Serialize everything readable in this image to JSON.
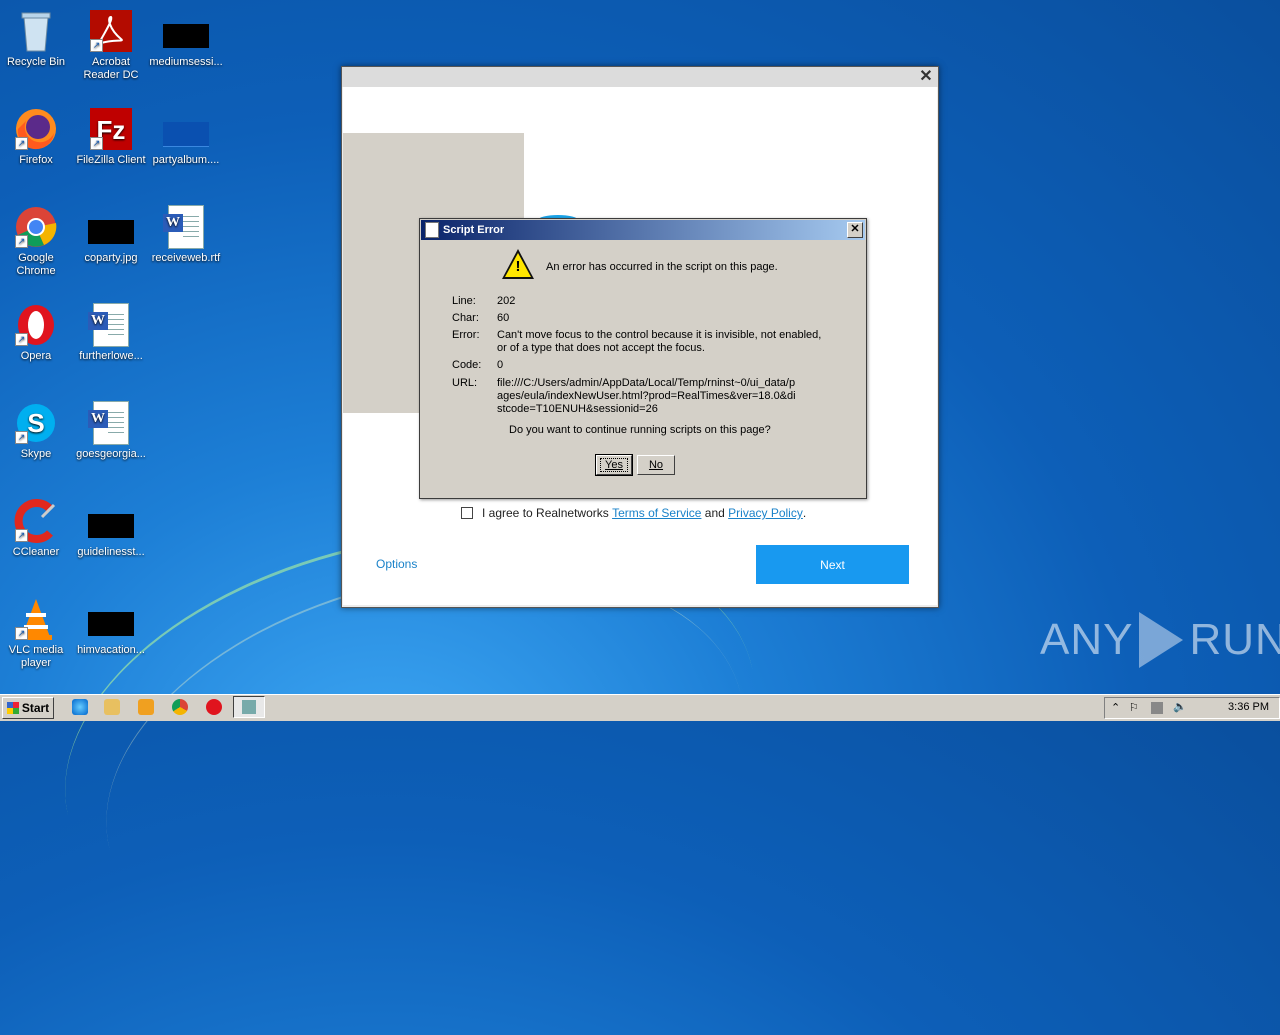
{
  "desktop": {
    "icons": [
      {
        "label": "Recycle Bin",
        "icon": "recycle-bin-icon"
      },
      {
        "label": "Acrobat Reader DC",
        "icon": "acrobat-icon"
      },
      {
        "label": "mediumsessi...",
        "icon": "black-thumbnail-icon"
      },
      {
        "label": "Firefox",
        "icon": "firefox-icon"
      },
      {
        "label": "FileZilla Client",
        "icon": "filezilla-icon"
      },
      {
        "label": "partyalbum....",
        "icon": "blue-thumbnail-icon"
      },
      {
        "label": "Google Chrome",
        "icon": "chrome-icon"
      },
      {
        "label": "coparty.jpg",
        "icon": "black-thumbnail-icon"
      },
      {
        "label": "receiveweb.rtf",
        "icon": "word-doc-icon"
      },
      {
        "label": "Opera",
        "icon": "opera-icon"
      },
      {
        "label": "furtherlowe...",
        "icon": "word-doc-icon"
      },
      {
        "label": "Skype",
        "icon": "skype-icon"
      },
      {
        "label": "goesgeorgia...",
        "icon": "word-doc-icon"
      },
      {
        "label": "CCleaner",
        "icon": "ccleaner-icon"
      },
      {
        "label": "guidelinesst...",
        "icon": "black-thumbnail-icon"
      },
      {
        "label": "VLC media player",
        "icon": "vlc-icon"
      },
      {
        "label": "himvacation...",
        "icon": "black-thumbnail-icon"
      }
    ]
  },
  "installer": {
    "agree_text": "I agree to Realnetworks",
    "terms_link": "Terms of Service",
    "and_text": "and",
    "privacy_link": "Privacy Policy",
    "period": ".",
    "options_label": "Options",
    "next_label": "Next",
    "close_glyph": "✕"
  },
  "script_error": {
    "title": "Script Error",
    "headline": "An error has occurred in the script on this page.",
    "rows": [
      {
        "key": "Line:",
        "value": "202"
      },
      {
        "key": "Char:",
        "value": "60"
      },
      {
        "key": "Error:",
        "value": "Can't move focus to the control because it is invisible, not enabled, or of a type that does not accept the focus."
      },
      {
        "key": "Code:",
        "value": "0"
      },
      {
        "key": "URL:",
        "value": "file:///C:/Users/admin/AppData/Local/Temp/rninst~0/ui_data/pages/eula/indexNewUser.html?prod=RealTimes&ver=18.0&distcode=T10ENUH&sessionid=26"
      }
    ],
    "question": "Do you want to continue running scripts on this page?",
    "yes_label": "Yes",
    "no_label": "No",
    "close_glyph": "✕"
  },
  "watermark": {
    "left": "ANY",
    "right": "RUN"
  },
  "taskbar": {
    "start_label": "Start",
    "clock": "3:36 PM",
    "tray_up_arrow": "⌃"
  },
  "colors": {
    "link": "#1a82c9",
    "next_button": "#1899f0",
    "dialog_title_start": "#0a246a"
  }
}
